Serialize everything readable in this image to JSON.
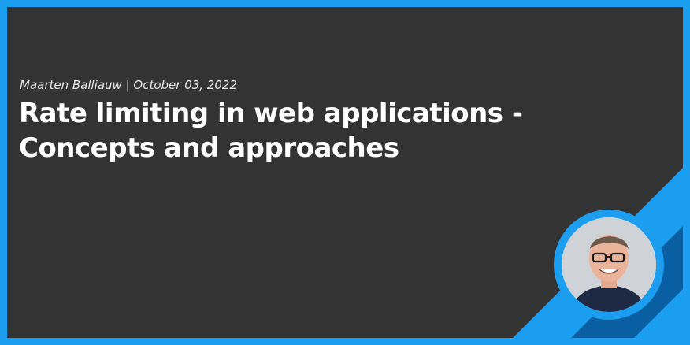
{
  "post": {
    "byline": "Maarten Balliauw | October 03, 2022",
    "title_line1": "Rate limiting in web applications -",
    "title_line2": "Concepts and approaches"
  },
  "colors": {
    "accent": "#1b9df0",
    "accent_dark": "#0a5fa3",
    "panel": "#333333",
    "text": "#ffffff"
  },
  "author": {
    "avatar_icon": "author-portrait"
  }
}
